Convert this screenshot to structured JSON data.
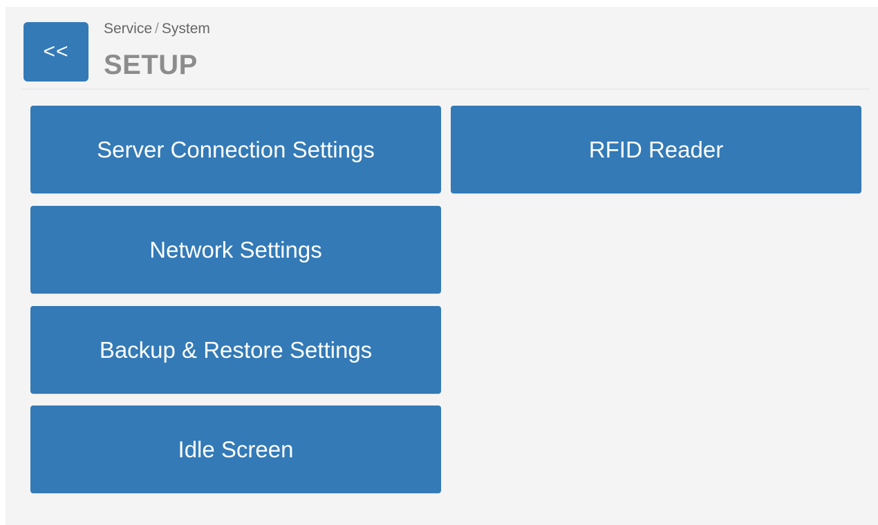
{
  "header": {
    "back_label": "<<",
    "breadcrumb": [
      "Service",
      "System"
    ],
    "breadcrumb_separator": "/",
    "title": "SETUP"
  },
  "tiles": [
    {
      "label": "Server Connection Settings"
    },
    {
      "label": "RFID Reader"
    },
    {
      "label": "Network Settings"
    },
    {
      "label": "Backup & Restore Settings"
    },
    {
      "label": "Idle Screen"
    }
  ],
  "colors": {
    "accent": "#337ab7",
    "background": "#f4f4f4",
    "title": "#8c8c8c"
  }
}
